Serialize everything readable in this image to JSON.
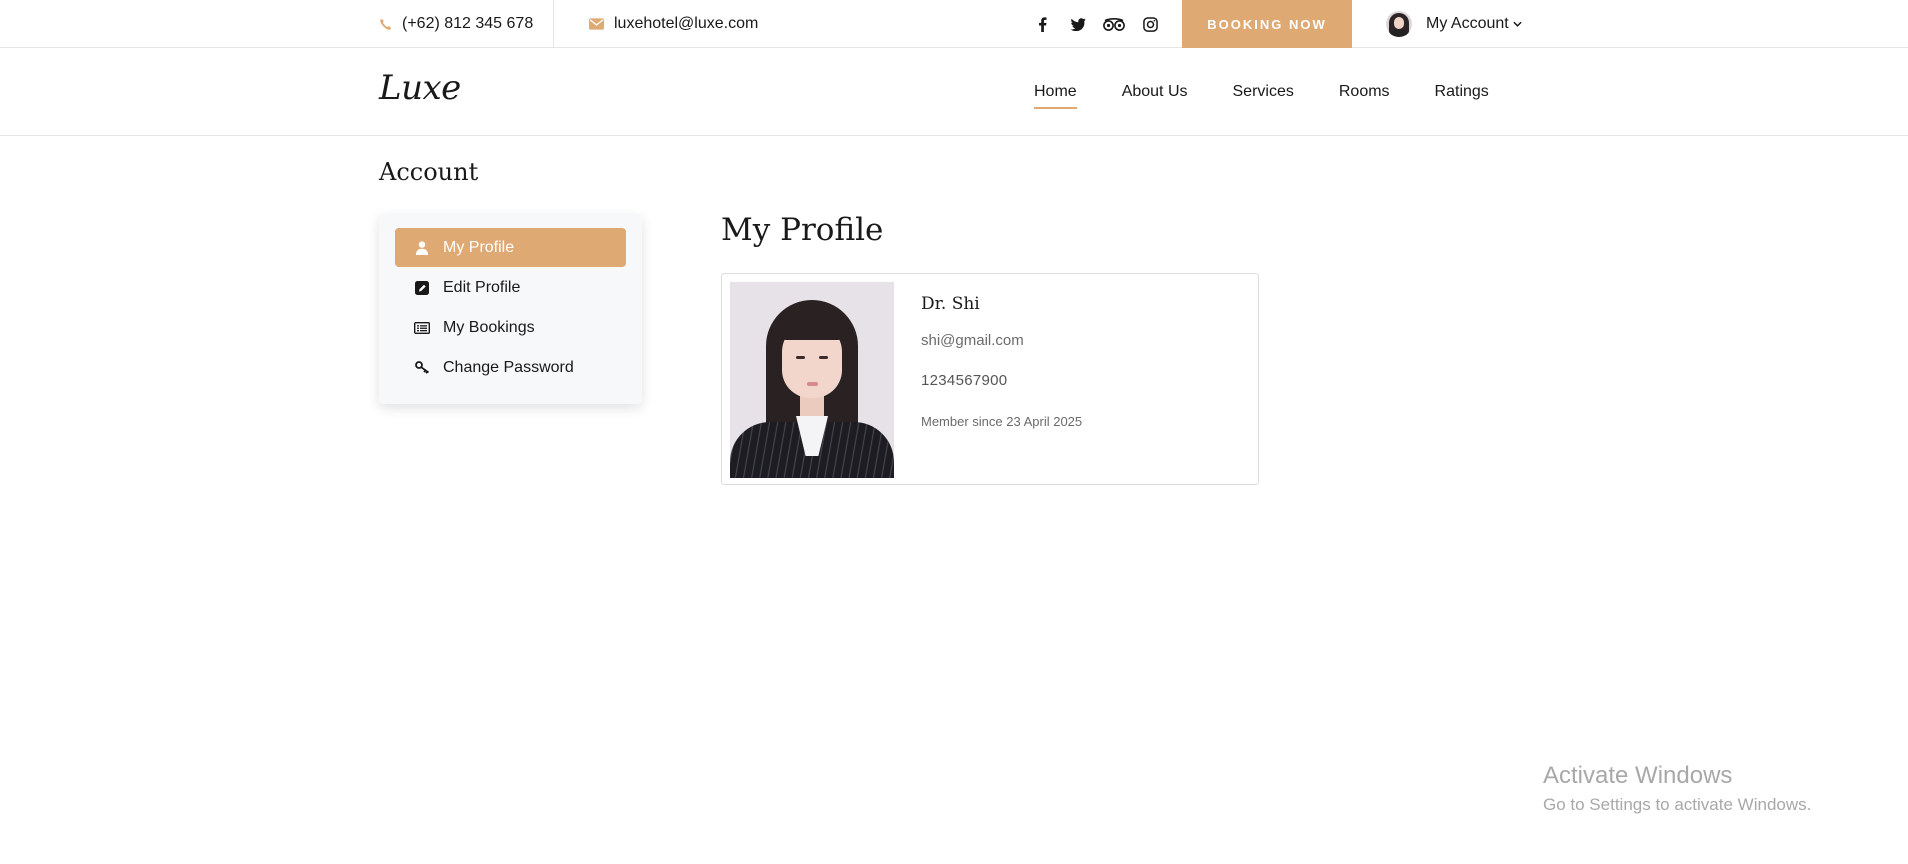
{
  "topbar": {
    "phone": "(+62) 812 345 678",
    "email": "luxehotel@luxe.com",
    "social": [
      "facebook-icon",
      "twitter-icon",
      "tripadvisor-icon",
      "instagram-icon"
    ],
    "booking_label": "BOOKING NOW",
    "account_label": "My Account"
  },
  "header": {
    "logo": "Luxe",
    "nav": [
      "Home",
      "About Us",
      "Services",
      "Rooms",
      "Ratings"
    ],
    "active_nav": "Home"
  },
  "account": {
    "heading": "Account",
    "menu": [
      {
        "label": "My Profile",
        "icon": "user-icon",
        "active": true
      },
      {
        "label": "Edit Profile",
        "icon": "edit-icon",
        "active": false
      },
      {
        "label": "My Bookings",
        "icon": "list-icon",
        "active": false
      },
      {
        "label": "Change Password",
        "icon": "key-icon",
        "active": false
      }
    ]
  },
  "profile": {
    "title": "My Profile",
    "name": "Dr. Shi",
    "email": "shi@gmail.com",
    "phone": "1234567900",
    "member_since": "Member since 23 April 2025"
  },
  "watermark": {
    "title": "Activate Windows",
    "subtitle": "Go to Settings to activate Windows."
  },
  "colors": {
    "accent": "#dfa974",
    "text": "#19191a",
    "border": "#e5e5e5"
  }
}
